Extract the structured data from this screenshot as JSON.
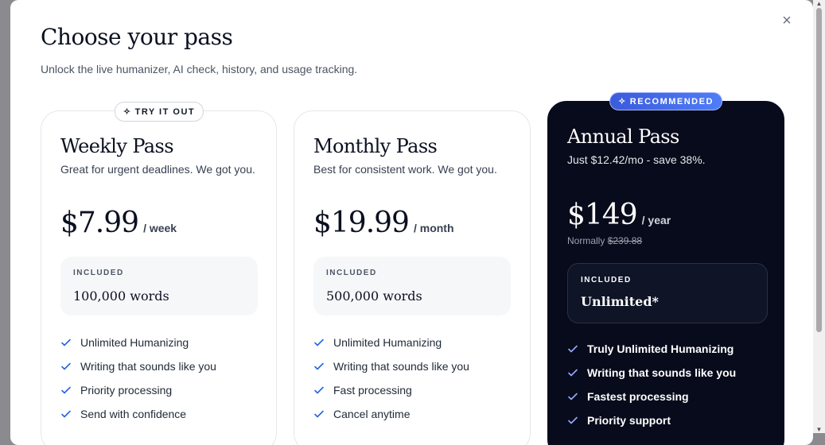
{
  "modal": {
    "title": "Choose your pass",
    "subtitle": "Unlock the live humanizer, AI check, history, and usage tracking.",
    "close_icon": "×"
  },
  "plans": [
    {
      "badge": "TRY IT OUT",
      "badge_icon": "sparkle-icon",
      "name": "Weekly Pass",
      "description": "Great for urgent deadlines. We got you.",
      "price": "$7.99",
      "period": "/ week",
      "included_label": "INCLUDED",
      "included_value": "100,000 words",
      "features": [
        "Unlimited Humanizing",
        "Writing that sounds like you",
        "Priority processing",
        "Send with confidence"
      ]
    },
    {
      "name": "Monthly Pass",
      "description": "Best for consistent work. We got you.",
      "price": "$19.99",
      "period": "/ month",
      "included_label": "INCLUDED",
      "included_value": "500,000 words",
      "features": [
        "Unlimited Humanizing",
        "Writing that sounds like you",
        "Fast processing",
        "Cancel anytime"
      ]
    },
    {
      "badge": "RECOMMENDED",
      "badge_icon": "sparkle-icon",
      "name": "Annual Pass",
      "description": "Just $12.42/mo - save 38%.",
      "price": "$149",
      "period": "/ year",
      "normally_label": "Normally",
      "normally_price": "$239.88",
      "included_label": "INCLUDED",
      "included_value": "Unlimited*",
      "features": [
        "Truly Unlimited Humanizing",
        "Writing that sounds like you",
        "Fastest processing",
        "Priority support"
      ]
    }
  ],
  "colors": {
    "accent": "#2563eb",
    "dark_card": "#070b1b",
    "recommended_badge": "#4f7df7"
  },
  "icons": {
    "check": "check-icon",
    "close": "close-icon",
    "sparkle": "✧"
  }
}
